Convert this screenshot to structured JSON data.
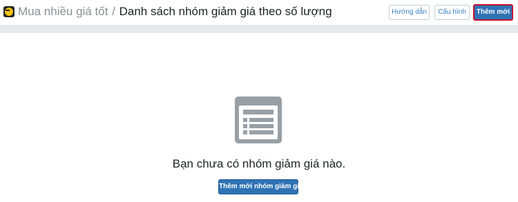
{
  "header": {
    "app_icon": "coin-app-icon",
    "breadcrumb_parent": "Mua nhiều giá tốt",
    "breadcrumb_separator": "/",
    "breadcrumb_current": "Danh sách nhóm giảm giá theo số lượng"
  },
  "toolbar": {
    "guide_label": "Hướng dẫn",
    "config_label": "Cấu hình",
    "add_label": "Thêm mới"
  },
  "empty_state": {
    "icon": "list-document-icon",
    "message": "Bạn chưa có nhóm giảm giá nào.",
    "add_button_label": "Thêm mới nhóm giảm giá"
  },
  "colors": {
    "primary": "#2f73b4",
    "highlight_border": "#c8102e",
    "icon_gray": "#98a0a6",
    "band_gray": "#e7e8ea"
  }
}
